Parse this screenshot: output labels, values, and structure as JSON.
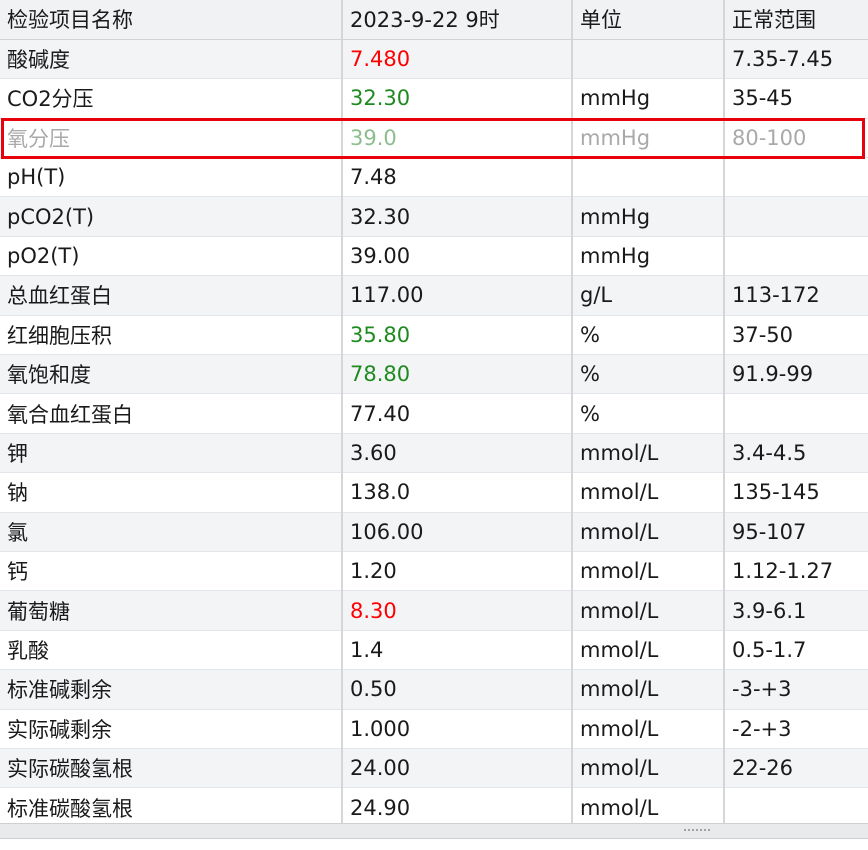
{
  "columns": [
    "检验项目名称",
    "2023-9-22 9时",
    "单位",
    "正常范围"
  ],
  "rows": [
    {
      "name": "酸碱度",
      "value": "7.480",
      "unit": "",
      "range": "7.35-7.45",
      "flag": "high"
    },
    {
      "name": "CO2分压",
      "value": "32.30",
      "unit": "mmHg",
      "range": "35-45",
      "flag": "low"
    },
    {
      "name": "氧分压",
      "value": "39.0",
      "unit": "mmHg",
      "range": "80-100",
      "flag": "low"
    },
    {
      "name": "pH(T)",
      "value": "7.48",
      "unit": "",
      "range": "",
      "flag": "normal"
    },
    {
      "name": "pCO2(T)",
      "value": "32.30",
      "unit": "mmHg",
      "range": "",
      "flag": "normal"
    },
    {
      "name": "pO2(T)",
      "value": "39.00",
      "unit": "mmHg",
      "range": "",
      "flag": "normal"
    },
    {
      "name": "总血红蛋白",
      "value": "117.00",
      "unit": "g/L",
      "range": "113-172",
      "flag": "normal"
    },
    {
      "name": "红细胞压积",
      "value": "35.80",
      "unit": "%",
      "range": "37-50",
      "flag": "low"
    },
    {
      "name": "氧饱和度",
      "value": "78.80",
      "unit": "%",
      "range": "91.9-99",
      "flag": "low"
    },
    {
      "name": "氧合血红蛋白",
      "value": "77.40",
      "unit": "%",
      "range": "",
      "flag": "normal"
    },
    {
      "name": "钾",
      "value": "3.60",
      "unit": "mmol/L",
      "range": "3.4-4.5",
      "flag": "normal"
    },
    {
      "name": "钠",
      "value": "138.0",
      "unit": "mmol/L",
      "range": "135-145",
      "flag": "normal"
    },
    {
      "name": "氯",
      "value": "106.00",
      "unit": "mmol/L",
      "range": "95-107",
      "flag": "normal"
    },
    {
      "name": "钙",
      "value": "1.20",
      "unit": "mmol/L",
      "range": "1.12-1.27",
      "flag": "normal"
    },
    {
      "name": "葡萄糖",
      "value": "8.30",
      "unit": "mmol/L",
      "range": "3.9-6.1",
      "flag": "high"
    },
    {
      "name": "乳酸",
      "value": "1.4",
      "unit": "mmol/L",
      "range": "0.5-1.7",
      "flag": "normal"
    },
    {
      "name": "标准碱剩余",
      "value": "0.50",
      "unit": "mmol/L",
      "range": "-3-+3",
      "flag": "normal"
    },
    {
      "name": "实际碱剩余",
      "value": "1.000",
      "unit": "mmol/L",
      "range": "-2-+3",
      "flag": "normal"
    },
    {
      "name": "实际碳酸氢根",
      "value": "24.00",
      "unit": "mmol/L",
      "range": "22-26",
      "flag": "normal"
    },
    {
      "name": "标准碳酸氢根",
      "value": "24.90",
      "unit": "mmol/L",
      "range": "",
      "flag": "normal"
    }
  ],
  "highlighted_row": 2,
  "colors": {
    "high": "#ff0000",
    "low": "#1f8a1f",
    "highlight_border": "#e8000b"
  }
}
